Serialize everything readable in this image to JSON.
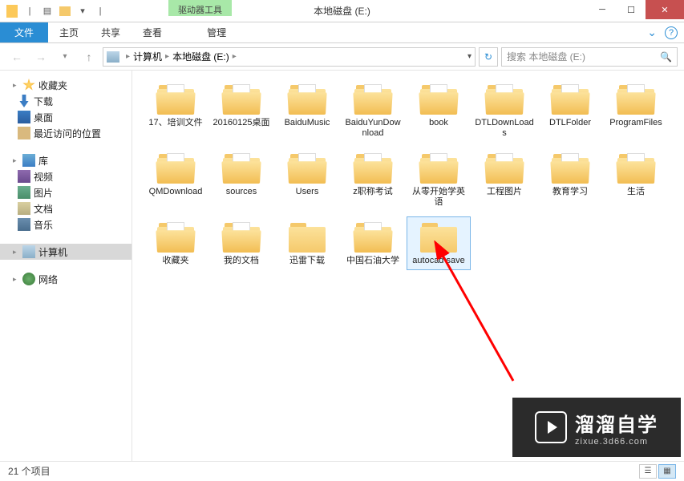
{
  "title": "本地磁盘 (E:)",
  "drive_tools_label": "驱动器工具",
  "ribbon": {
    "file": "文件",
    "home": "主页",
    "share": "共享",
    "view": "查看",
    "manage": "管理"
  },
  "breadcrumb": {
    "computer": "计算机",
    "drive": "本地磁盘 (E:)"
  },
  "search_placeholder": "搜索 本地磁盘 (E:)",
  "sidebar": {
    "favorites": "收藏夹",
    "downloads": "下载",
    "desktop": "桌面",
    "recent": "最近访问的位置",
    "library": "库",
    "video": "视频",
    "pictures": "图片",
    "documents": "文档",
    "music": "音乐",
    "computer": "计算机",
    "network": "网络"
  },
  "folders": [
    {
      "name": "17、培训文件",
      "paper": true
    },
    {
      "name": "20160125桌面",
      "paper": true
    },
    {
      "name": "BaiduMusic",
      "paper": true
    },
    {
      "name": "BaiduYunDownload",
      "paper": true
    },
    {
      "name": "book",
      "paper": true
    },
    {
      "name": "DTLDownLoads",
      "paper": true
    },
    {
      "name": "DTLFolder",
      "paper": true
    },
    {
      "name": "ProgramFiles",
      "paper": true
    },
    {
      "name": "QMDownload",
      "paper": true
    },
    {
      "name": "sources",
      "paper": true
    },
    {
      "name": "Users",
      "paper": true
    },
    {
      "name": "z职称考试",
      "paper": true
    },
    {
      "name": "从零开始学英语",
      "paper": true
    },
    {
      "name": "工程图片",
      "paper": true
    },
    {
      "name": "教育学习",
      "paper": true
    },
    {
      "name": "生活",
      "paper": true
    },
    {
      "name": "收藏夹",
      "paper": true
    },
    {
      "name": "我的文档",
      "paper": true
    },
    {
      "name": "迅雷下载",
      "paper": false
    },
    {
      "name": "中国石油大学",
      "paper": true
    },
    {
      "name": "autocad save",
      "paper": false,
      "selected": true
    }
  ],
  "status": "21 个项目",
  "watermark": {
    "main": "溜溜自学",
    "sub": "zixue.3d66.com"
  }
}
